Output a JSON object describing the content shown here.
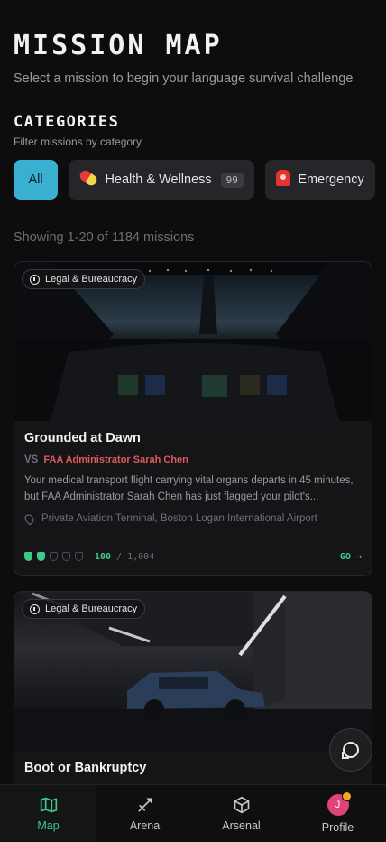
{
  "header": {
    "title": "MISSION MAP",
    "subtitle": "Select a mission to begin your language survival challenge"
  },
  "categories": {
    "title": "CATEGORIES",
    "subtitle": "Filter missions by category",
    "chips": [
      {
        "label": "All",
        "active": true
      },
      {
        "label": "Health & Wellness",
        "count": "99",
        "icon": "pill-icon"
      },
      {
        "label": "Emergency",
        "icon": "siren-icon"
      }
    ]
  },
  "showing": "Showing 1-20 of 1184 missions",
  "missions": [
    {
      "tag": "Legal & Bureaucracy",
      "title": "Grounded at Dawn",
      "vs": "VS",
      "opponent": "FAA Administrator Sarah Chen",
      "description": "Your medical transport flight carrying vital organs departs in 45 minutes, but FAA Administrator Sarah Chen has just flagged your pilot's...",
      "location": "Private Aviation Terminal, Boston Logan International Airport",
      "score": "100",
      "score_total": "1,004",
      "shields_filled": 2,
      "shields_total": 5,
      "go": "GO →"
    },
    {
      "tag": "Legal & Bureaucracy",
      "title": "Boot or Bankruptcy"
    }
  ],
  "tabbar": {
    "items": [
      {
        "label": "Map",
        "icon": "map-icon",
        "active": true
      },
      {
        "label": "Arena",
        "icon": "sword-icon"
      },
      {
        "label": "Arsenal",
        "icon": "box-icon"
      },
      {
        "label": "Profile",
        "icon": "avatar",
        "avatar_letter": "J"
      }
    ]
  },
  "colors": {
    "accent": "#3ab0d0",
    "success": "#3ec98a",
    "danger": "#e05a5a"
  }
}
